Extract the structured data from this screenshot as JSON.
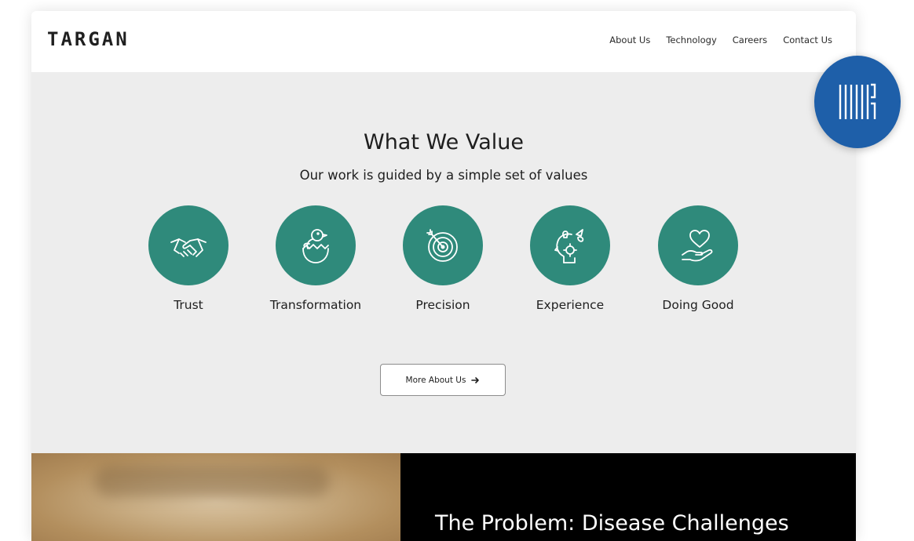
{
  "header": {
    "logo_text": "TARGAN",
    "nav": [
      {
        "label": "About Us"
      },
      {
        "label": "Technology"
      },
      {
        "label": "Careers"
      },
      {
        "label": "Contact Us"
      }
    ]
  },
  "values_section": {
    "title": "What We Value",
    "subtitle": "Our work is guided by a simple set of values",
    "items": [
      {
        "label": "Trust",
        "icon": "handshake-icon"
      },
      {
        "label": "Transformation",
        "icon": "hatching-chick-icon"
      },
      {
        "label": "Precision",
        "icon": "target-icon"
      },
      {
        "label": "Experience",
        "icon": "head-ideas-icon"
      },
      {
        "label": "Doing Good",
        "icon": "heart-in-hand-icon"
      }
    ],
    "more_button": {
      "label": "More About Us",
      "icon": "arrow-right-icon"
    }
  },
  "problem_section": {
    "title": "The Problem: Disease Challenges"
  },
  "floating_widget": {
    "icon": "vertical-bars-logo-icon"
  },
  "colors": {
    "accent_teal": "#2f8a7b",
    "widget_blue": "#1e5fa9",
    "page_bg": "#ededed"
  }
}
